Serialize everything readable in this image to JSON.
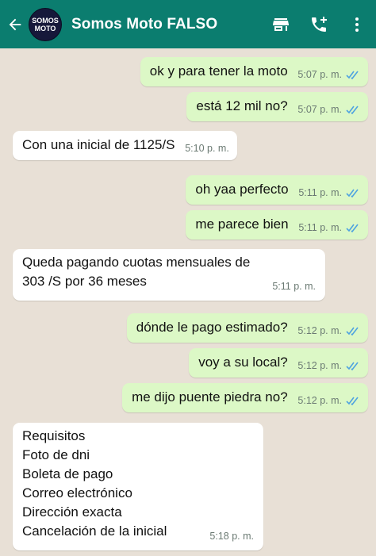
{
  "header": {
    "title": "Somos Moto FALSO",
    "avatar_line1": "SOMOS",
    "avatar_line2": "MOTO",
    "colors": {
      "bar": "#0b7d6f",
      "outgoing": "#dcf8c6",
      "incoming": "#ffffff",
      "ticks": "#4fa3e0"
    }
  },
  "messages": [
    {
      "dir": "out",
      "text": "ok y para tener la moto",
      "time": "5:07 p. m.",
      "read": true
    },
    {
      "dir": "out",
      "text": "está 12 mil no?",
      "time": "5:07 p. m.",
      "read": true
    },
    {
      "dir": "in",
      "text": "Con una inicial de 1125/S",
      "time": "5:10 p. m."
    },
    {
      "dir": "out",
      "text": "oh yaa perfecto",
      "time": "5:11 p. m.",
      "read": true
    },
    {
      "dir": "out",
      "text": "me parece bien",
      "time": "5:11 p. m.",
      "read": true
    },
    {
      "dir": "in",
      "text": "Queda pagando cuotas mensuales de\n303 /S por 36 meses",
      "time": "5:11 p. m."
    },
    {
      "dir": "out",
      "text": "dónde le pago estimado?",
      "time": "5:12 p. m.",
      "read": true
    },
    {
      "dir": "out",
      "text": "voy a su local?",
      "time": "5:12 p. m.",
      "read": true
    },
    {
      "dir": "out",
      "text": "me dijo puente piedra no?",
      "time": "5:12 p. m.",
      "read": true
    },
    {
      "dir": "in",
      "text": "Requisitos\nFoto de dni\nBoleta de pago\nCorreo electrónico\nDirección exacta\nCancelación de la inicial",
      "time": "5:18 p. m."
    }
  ]
}
